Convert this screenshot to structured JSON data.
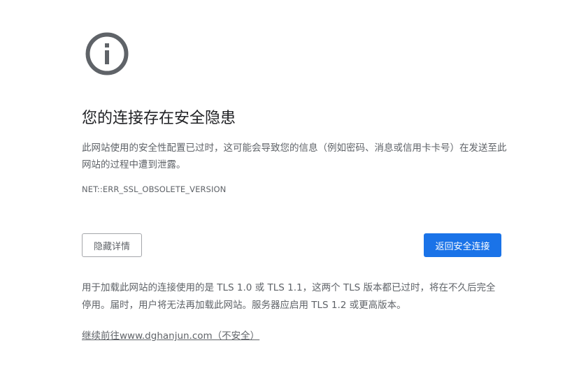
{
  "icon": "info-circle-icon",
  "colors": {
    "icon": "#5f6368",
    "primary_button": "#1a73e8",
    "text_secondary": "#5f6368",
    "title": "#202124"
  },
  "header": {
    "title": "您的连接存在安全隐患"
  },
  "main": {
    "description": "此网站使用的安全性配置已过时，这可能会导致您的信息（例如密码、消息或信用卡卡号）在发送至此网站的过程中遭到泄露。",
    "error_code": "NET::ERR_SSL_OBSOLETE_VERSION",
    "explanation": "用于加载此网站的连接使用的是 TLS 1.0 或 TLS 1.1，这两个 TLS 版本都已过时，将在不久后完全停用。届时，用户将无法再加载此网站。服务器应启用 TLS 1.2 或更高版本。",
    "proceed_link": "继续前往www.dghanjun.com（不安全）"
  },
  "buttons": {
    "details_label": "隐藏详情",
    "back_label": "返回安全连接"
  }
}
